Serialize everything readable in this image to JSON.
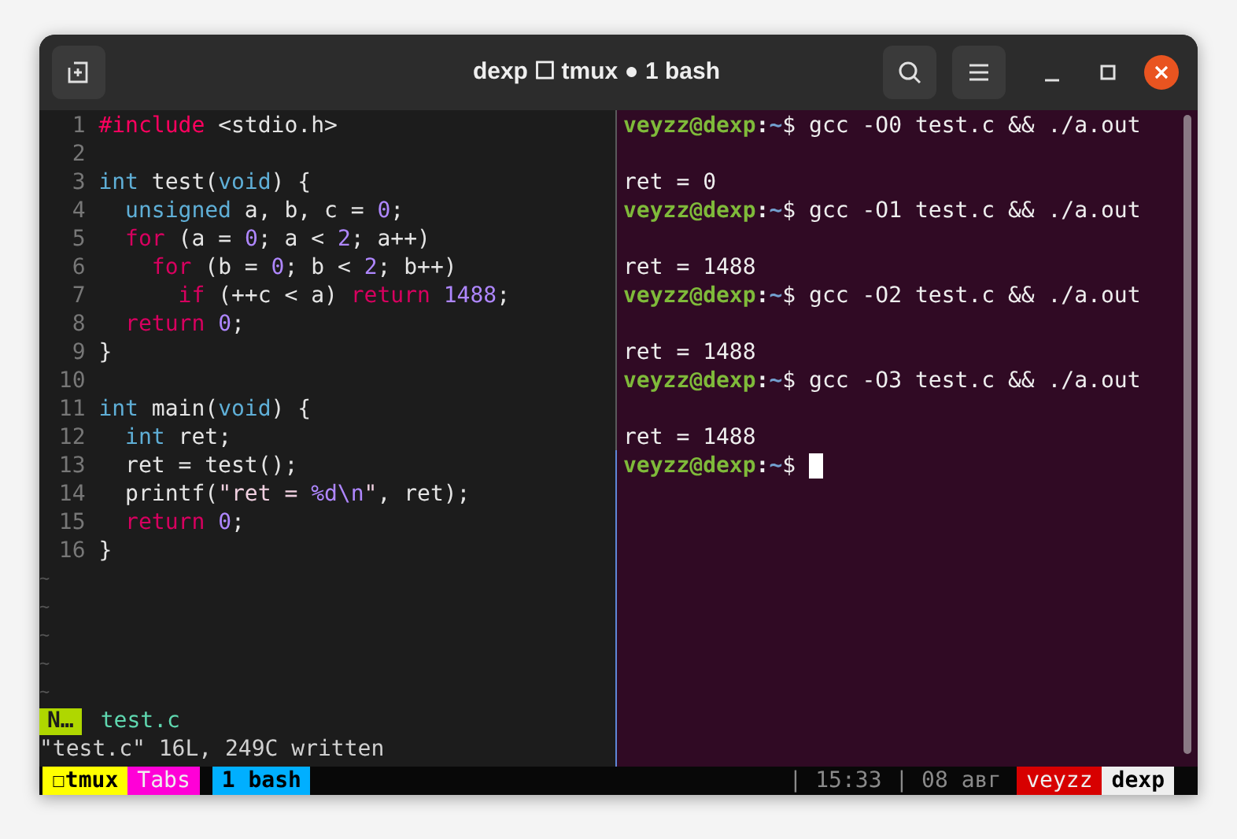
{
  "window": {
    "title": "dexp ☐ tmux ● 1 bash"
  },
  "editor": {
    "lines": [
      {
        "number": "1",
        "segments": [
          {
            "kind": "preproc",
            "text": "#include"
          },
          {
            "kind": "plain",
            "text": " <stdio.h>"
          }
        ]
      },
      {
        "number": "2"
      },
      {
        "number": "3",
        "segments": [
          {
            "kind": "type",
            "text": "int"
          },
          {
            "kind": "plain",
            "text": " test("
          },
          {
            "kind": "type",
            "text": "void"
          },
          {
            "kind": "plain",
            "text": ") {"
          }
        ]
      },
      {
        "number": "4",
        "segments": [
          {
            "kind": "type",
            "text": "  unsigned"
          },
          {
            "kind": "plain",
            "text": " a, b, c = "
          },
          {
            "kind": "number",
            "text": "0"
          },
          {
            "kind": "plain",
            "text": ";"
          }
        ]
      },
      {
        "number": "5",
        "segments": [
          {
            "kind": "keyword",
            "text": "  for"
          },
          {
            "kind": "plain",
            "text": " (a = "
          },
          {
            "kind": "number",
            "text": "0"
          },
          {
            "kind": "plain",
            "text": "; a < "
          },
          {
            "kind": "number",
            "text": "2"
          },
          {
            "kind": "plain",
            "text": "; a++)"
          }
        ]
      },
      {
        "number": "6",
        "segments": [
          {
            "kind": "keyword",
            "text": "    for"
          },
          {
            "kind": "plain",
            "text": " (b = "
          },
          {
            "kind": "number",
            "text": "0"
          },
          {
            "kind": "plain",
            "text": "; b < "
          },
          {
            "kind": "number",
            "text": "2"
          },
          {
            "kind": "plain",
            "text": "; b++)"
          }
        ]
      },
      {
        "number": "7",
        "segments": [
          {
            "kind": "keyword",
            "text": "      if"
          },
          {
            "kind": "plain",
            "text": " (++c < a) "
          },
          {
            "kind": "keyword",
            "text": "return"
          },
          {
            "kind": "number",
            "text": " 1488"
          },
          {
            "kind": "plain",
            "text": ";"
          }
        ]
      },
      {
        "number": "8",
        "segments": [
          {
            "kind": "keyword",
            "text": "  return"
          },
          {
            "kind": "number",
            "text": " 0"
          },
          {
            "kind": "plain",
            "text": ";"
          }
        ]
      },
      {
        "number": "9",
        "segments": [
          {
            "kind": "plain",
            "text": "}"
          }
        ]
      },
      {
        "number": "10"
      },
      {
        "number": "11",
        "segments": [
          {
            "kind": "type",
            "text": "int"
          },
          {
            "kind": "plain",
            "text": " main("
          },
          {
            "kind": "type",
            "text": "void"
          },
          {
            "kind": "plain",
            "text": ") {"
          }
        ]
      },
      {
        "number": "12",
        "segments": [
          {
            "kind": "type",
            "text": "  int"
          },
          {
            "kind": "plain",
            "text": " ret;"
          }
        ]
      },
      {
        "number": "13",
        "segments": [
          {
            "kind": "plain",
            "text": "  ret = test();"
          }
        ]
      },
      {
        "number": "14",
        "segments": [
          {
            "kind": "plain",
            "text": "  printf("
          },
          {
            "kind": "string",
            "text": "\"ret = "
          },
          {
            "kind": "number",
            "text": "%d\\n"
          },
          {
            "kind": "string",
            "text": "\""
          },
          {
            "kind": "plain",
            "text": ", ret);"
          }
        ]
      },
      {
        "number": "15",
        "segments": [
          {
            "kind": "keyword",
            "text": "  return"
          },
          {
            "kind": "number",
            "text": " 0"
          },
          {
            "kind": "plain",
            "text": ";"
          }
        ]
      },
      {
        "number": "16",
        "segments": [
          {
            "kind": "plain",
            "text": "}"
          }
        ]
      }
    ],
    "filler": [
      "~",
      "~",
      "~",
      "~",
      "~"
    ],
    "statusline": {
      "mode": "N…",
      "file": "test.c"
    },
    "message": "\"test.c\" 16L, 249C written"
  },
  "terminal": {
    "lines": [
      {
        "kind": "prompt",
        "user": "veyzz@dexp",
        "separator": ":",
        "path": "~",
        "sign": "$",
        "command": "gcc -O0 test.c && ./a.out"
      },
      {
        "kind": "blank"
      },
      {
        "kind": "output",
        "text": "ret = 0"
      },
      {
        "kind": "prompt",
        "user": "veyzz@dexp",
        "separator": ":",
        "path": "~",
        "sign": "$",
        "command": "gcc -O1 test.c && ./a.out"
      },
      {
        "kind": "blank"
      },
      {
        "kind": "output",
        "text": "ret = 1488"
      },
      {
        "kind": "prompt",
        "user": "veyzz@dexp",
        "separator": ":",
        "path": "~",
        "sign": "$",
        "command": "gcc -O2 test.c && ./a.out"
      },
      {
        "kind": "blank"
      },
      {
        "kind": "output",
        "text": "ret = 1488"
      },
      {
        "kind": "prompt",
        "user": "veyzz@dexp",
        "separator": ":",
        "path": "~",
        "sign": "$",
        "command": "gcc -O3 test.c && ./a.out"
      },
      {
        "kind": "blank"
      },
      {
        "kind": "output",
        "text": "ret = 1488"
      },
      {
        "kind": "prompt",
        "user": "veyzz@dexp",
        "separator": ":",
        "path": "~",
        "sign": "$",
        "cursor": true
      }
    ]
  },
  "tmux_bar": {
    "left": [
      {
        "text": "☐tmux",
        "color": "#ffff00"
      },
      {
        "text": "Tabs",
        "color": "#ff00d7"
      },
      {
        "text": "1 bash",
        "color": "#00afff"
      }
    ],
    "clock": "| 15:33 | 08 авг",
    "right": [
      {
        "text": "veyzz",
        "color": "#d70000"
      },
      {
        "text": "dexp",
        "color": "#eeeeee"
      }
    ]
  }
}
